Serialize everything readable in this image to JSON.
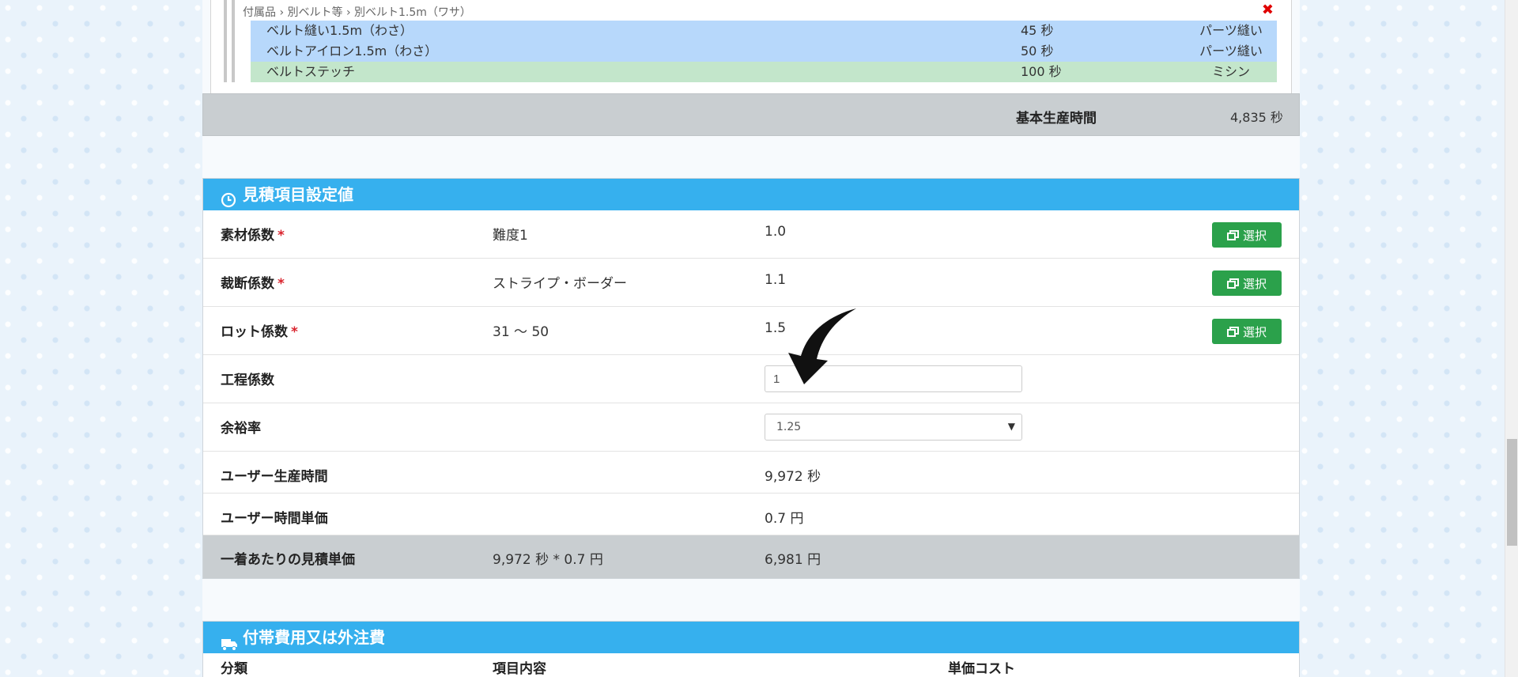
{
  "breakdown": {
    "path": "付属品 › 別ベルト等 › 別ベルト1.5m（ワサ）",
    "rows": [
      {
        "name": "ベルト縫い1.5m（わさ）",
        "time": "45 秒",
        "kind": "パーツ縫い",
        "color": "#b7d8fb"
      },
      {
        "name": "ベルトアイロン1.5m（わさ）",
        "time": "50 秒",
        "kind": "パーツ縫い",
        "color": "#b7d8fb"
      },
      {
        "name": "ベルトステッチ",
        "time": "100 秒",
        "kind": "ミシン",
        "color": "#c3e6cb"
      }
    ],
    "basic_label": "基本生産時間",
    "basic_value": "4,835 秒"
  },
  "estimate": {
    "title": "見積項目設定値",
    "icon": "clock-icon",
    "header_color": "#36b0ee",
    "required_mark": "*",
    "button_label": "選択",
    "button_color": "#2ba14b",
    "rows": [
      {
        "label": "素材係数",
        "desc": "難度1",
        "value": "1.0"
      },
      {
        "label": "裁断係数",
        "desc": "ストライプ・ボーダー",
        "value": "1.1"
      },
      {
        "label": "ロット係数",
        "desc": "31 〜 50",
        "value": "1.5"
      }
    ],
    "process_label": "工程係数",
    "process_value": "1",
    "margin_label": "余裕率",
    "margin_value": "1.25",
    "user_time_label": "ユーザー生産時間",
    "user_time_value": "9,972 秒",
    "user_rate_label": "ユーザー時間単価",
    "user_rate_value": "0.7 円",
    "total_label": "一着あたりの見積単価",
    "total_formula": "9,972 秒 * 0.7 円",
    "total_value": "6,981 円"
  },
  "incidental": {
    "title": "付帯費用又は外注費",
    "icon": "truck-icon",
    "columns": [
      "分類",
      "項目内容",
      "単価コスト"
    ]
  }
}
